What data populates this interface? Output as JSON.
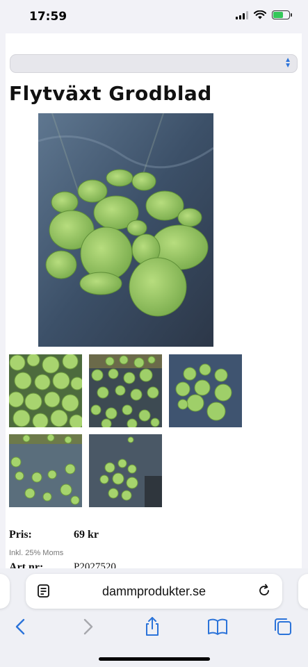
{
  "status": {
    "time": "17:59"
  },
  "page": {
    "title": "Flytväxt Grodblad",
    "price_label": "Pris:",
    "price_value": "69 kr",
    "vat_note": "Inkl. 25% Moms",
    "art_label": "Art.nr:",
    "art_value": "P2027520"
  },
  "browser": {
    "url": "dammprodukter.se"
  },
  "icons": {
    "select": "chevron-up-down-icon",
    "reader": "reader-mode-icon",
    "reload": "reload-icon",
    "back": "back-chevron-icon",
    "forward": "forward-chevron-icon",
    "share": "share-icon",
    "bookmarks": "book-icon",
    "tabs": "tabs-icon"
  },
  "colors": {
    "accent": "#2b73d9",
    "battery": "#34c759"
  }
}
